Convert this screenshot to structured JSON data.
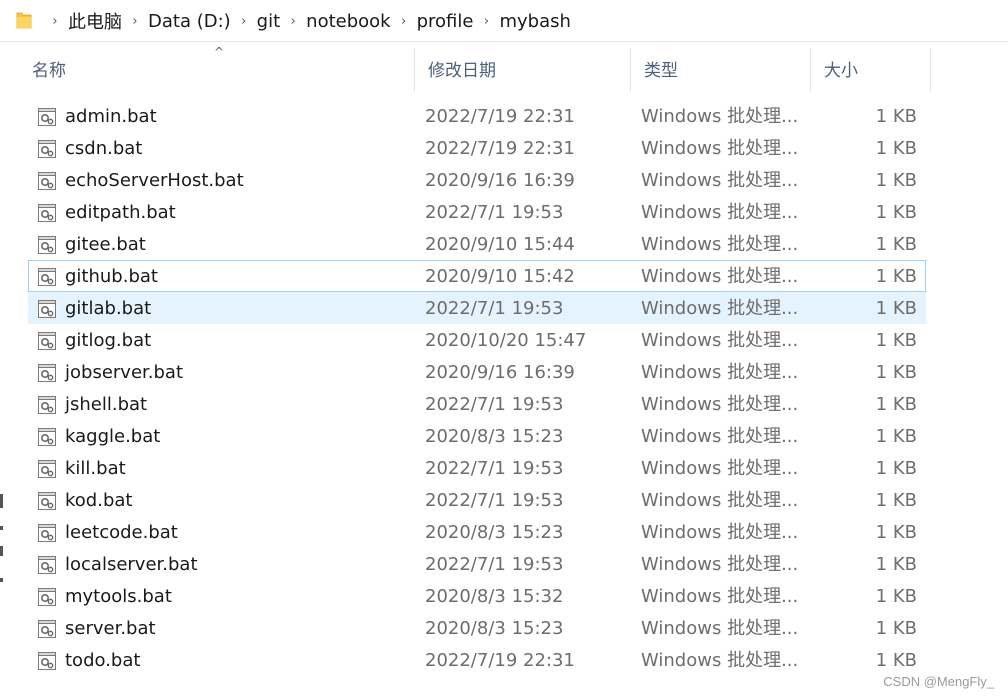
{
  "breadcrumb": {
    "items": [
      "此电脑",
      "Data (D:)",
      "git",
      "notebook",
      "profile",
      "mybash"
    ],
    "separator": "›"
  },
  "columns": {
    "name": "名称",
    "date": "修改日期",
    "type": "类型",
    "size": "大小",
    "sort_indicator": "^"
  },
  "files": [
    {
      "name": "admin.bat",
      "date": "2022/7/19 22:31",
      "type": "Windows 批处理...",
      "size": "1 KB"
    },
    {
      "name": "csdn.bat",
      "date": "2022/7/19 22:31",
      "type": "Windows 批处理...",
      "size": "1 KB"
    },
    {
      "name": "echoServerHost.bat",
      "date": "2020/9/16 16:39",
      "type": "Windows 批处理...",
      "size": "1 KB"
    },
    {
      "name": "editpath.bat",
      "date": "2022/7/1 19:53",
      "type": "Windows 批处理...",
      "size": "1 KB"
    },
    {
      "name": "gitee.bat",
      "date": "2020/9/10 15:44",
      "type": "Windows 批处理...",
      "size": "1 KB"
    },
    {
      "name": "github.bat",
      "date": "2020/9/10 15:42",
      "type": "Windows 批处理...",
      "size": "1 KB"
    },
    {
      "name": "gitlab.bat",
      "date": "2022/7/1 19:53",
      "type": "Windows 批处理...",
      "size": "1 KB"
    },
    {
      "name": "gitlog.bat",
      "date": "2020/10/20 15:47",
      "type": "Windows 批处理...",
      "size": "1 KB"
    },
    {
      "name": "jobserver.bat",
      "date": "2020/9/16 16:39",
      "type": "Windows 批处理...",
      "size": "1 KB"
    },
    {
      "name": "jshell.bat",
      "date": "2022/7/1 19:53",
      "type": "Windows 批处理...",
      "size": "1 KB"
    },
    {
      "name": "kaggle.bat",
      "date": "2020/8/3 15:23",
      "type": "Windows 批处理...",
      "size": "1 KB"
    },
    {
      "name": "kill.bat",
      "date": "2022/7/1 19:53",
      "type": "Windows 批处理...",
      "size": "1 KB"
    },
    {
      "name": "kod.bat",
      "date": "2022/7/1 19:53",
      "type": "Windows 批处理...",
      "size": "1 KB"
    },
    {
      "name": "leetcode.bat",
      "date": "2020/8/3 15:23",
      "type": "Windows 批处理...",
      "size": "1 KB"
    },
    {
      "name": "localserver.bat",
      "date": "2022/7/1 19:53",
      "type": "Windows 批处理...",
      "size": "1 KB"
    },
    {
      "name": "mytools.bat",
      "date": "2020/8/3 15:32",
      "type": "Windows 批处理...",
      "size": "1 KB"
    },
    {
      "name": "server.bat",
      "date": "2020/8/3 15:23",
      "type": "Windows 批处理...",
      "size": "1 KB"
    },
    {
      "name": "todo.bat",
      "date": "2022/7/19 22:31",
      "type": "Windows 批处理...",
      "size": "1 KB"
    }
  ],
  "hovered_file": "github.bat",
  "selected_file": "gitlab.bat",
  "icons": {
    "folder": "folder-icon",
    "file": "batch-file-icon",
    "separator": "chevron-right-icon"
  },
  "colors": {
    "header_text": "#4c607a",
    "secondary_text": "#6d6d6d",
    "selection_bg": "#e5f3ff",
    "hover_border": "#99d1ff",
    "folder_yellow": "#f8c537"
  },
  "watermark": "CSDN @MengFly_"
}
